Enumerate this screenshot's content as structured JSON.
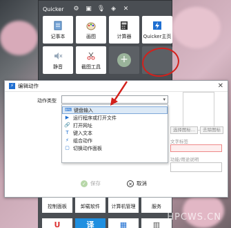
{
  "quicker": {
    "title": "Quicker",
    "toolbar_icons": [
      "gear-icon",
      "shirt-icon",
      "microphone-icon",
      "cube-icon",
      "close-icon"
    ],
    "tiles": [
      {
        "label": "记事本",
        "icon": "notepad-icon"
      },
      {
        "label": "画图",
        "icon": "paint-icon"
      },
      {
        "label": "计算器",
        "icon": "calculator-icon"
      },
      {
        "label": "Quicker主页",
        "icon": "quicker-logo-icon"
      },
      {
        "label": "静音",
        "icon": "mute-icon"
      },
      {
        "label": "截图工具",
        "icon": "scissors-icon"
      },
      {
        "label": "+",
        "icon": "add-icon"
      }
    ]
  },
  "dialog": {
    "title": "编辑动作",
    "action_type_label": "动作类型",
    "action_type_value": "",
    "dropdown_options": [
      {
        "label": "键盘输入",
        "icon": "keyboard-icon",
        "selected": true
      },
      {
        "label": "运行程序或打开文件",
        "icon": "run-icon",
        "selected": false
      },
      {
        "label": "打开网址",
        "icon": "link-icon",
        "selected": false
      },
      {
        "label": "键入文本",
        "icon": "text-icon",
        "selected": false
      },
      {
        "label": "组合动作",
        "icon": "combo-icon",
        "selected": false
      },
      {
        "label": "切换动作面板",
        "icon": "panel-icon",
        "selected": false
      }
    ],
    "select_icon_button": "选择图标...",
    "clear_icon_button": "去除图标",
    "text_label": "文字标签",
    "description_label": "功能/用途说明",
    "save_label": "保存",
    "cancel_label": "取消"
  },
  "bottom_panel": {
    "tiles": [
      "控制面板",
      "卸载软件",
      "计算机管理",
      "服务"
    ]
  },
  "watermark": "HPCWS.CN"
}
